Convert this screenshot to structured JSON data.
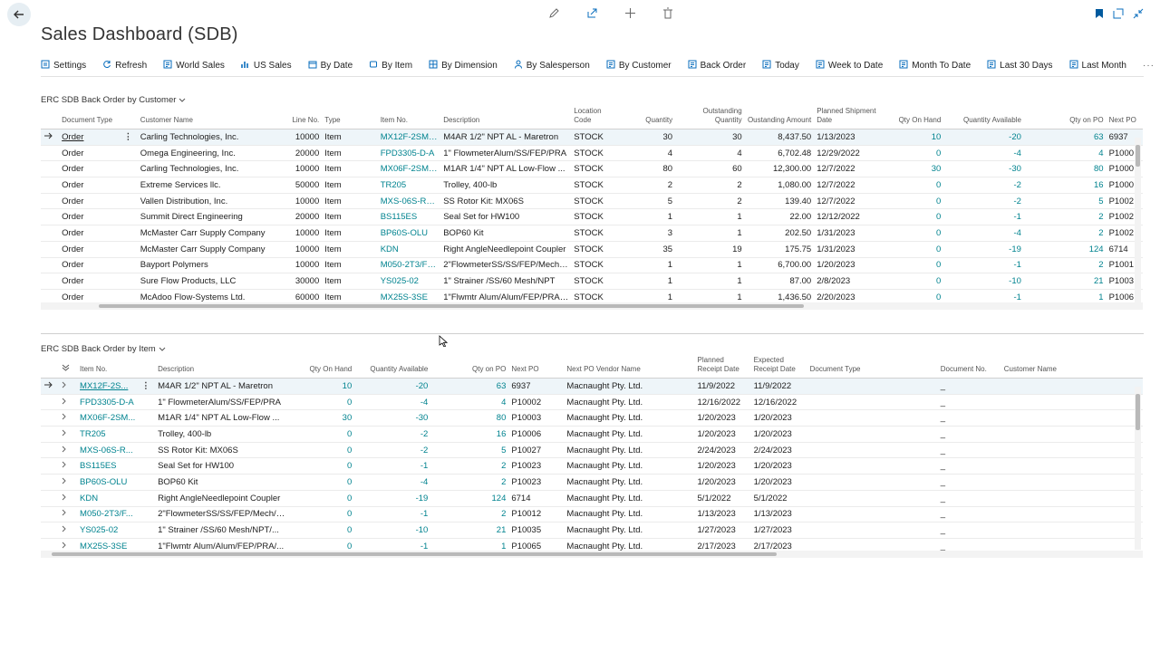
{
  "page": {
    "title": "Sales Dashboard (SDB)"
  },
  "toolbar": [
    {
      "label": "Settings",
      "icon": "settings-icon"
    },
    {
      "label": "Refresh",
      "icon": "refresh-icon"
    },
    {
      "label": "World Sales",
      "icon": "report-icon"
    },
    {
      "label": "US Sales",
      "icon": "chart-icon"
    },
    {
      "label": "By Date",
      "icon": "calendar-icon"
    },
    {
      "label": "By Item",
      "icon": "item-icon"
    },
    {
      "label": "By Dimension",
      "icon": "dimension-icon"
    },
    {
      "label": "By Salesperson",
      "icon": "person-icon"
    },
    {
      "label": "By Customer",
      "icon": "report-icon"
    },
    {
      "label": "Back Order",
      "icon": "report-icon"
    },
    {
      "label": "Today",
      "icon": "report-icon"
    },
    {
      "label": "Week to Date",
      "icon": "report-icon"
    },
    {
      "label": "Month To Date",
      "icon": "report-icon"
    },
    {
      "label": "Last 30 Days",
      "icon": "report-icon"
    },
    {
      "label": "Last Month",
      "icon": "report-icon"
    }
  ],
  "more_label": "···",
  "customer_part": {
    "caption": "ERC SDB Back Order by Customer",
    "headers": {
      "doc_type": "Document Type",
      "customer": "Customer Name",
      "line": "Line No.",
      "type": "Type",
      "item": "Item No.",
      "desc": "Description",
      "loc": "Location Code",
      "qty": "Quantity",
      "outq": "Outstanding Quantity",
      "outamt": "Oustanding Amount",
      "ship": "Planned Shipment Date",
      "onhand": "Qty On Hand",
      "avail": "Quantity Available",
      "onpo": "Qty on PO",
      "nextpo": "Next PO"
    },
    "rows": [
      {
        "doc": "Order",
        "cust": "Carling Technologies, Inc.",
        "line": "10000",
        "type": "Item",
        "item": "MX12F-2SM-...",
        "desc": "M4AR 1/2\" NPT AL - Maretron",
        "loc": "STOCK",
        "qty": "30",
        "outq": "30",
        "amt": "8,437.50",
        "ship": "1/13/2023",
        "onhand": "10",
        "avail": "-20",
        "onpo": "63",
        "nextpo": "6937"
      },
      {
        "doc": "Order",
        "cust": "Omega Engineering, Inc.",
        "line": "20000",
        "type": "Item",
        "item": "FPD3305-D-A",
        "desc": "1\" FlowmeterAlum/SS/FEP/PRA",
        "loc": "STOCK",
        "qty": "4",
        "outq": "4",
        "amt": "6,702.48",
        "ship": "12/29/2022",
        "onhand": "0",
        "avail": "-4",
        "onpo": "4",
        "nextpo": "P1000"
      },
      {
        "doc": "Order",
        "cust": "Carling Technologies, Inc.",
        "line": "10000",
        "type": "Item",
        "item": "MX06F-2SM-...",
        "desc": "M1AR 1/4\" NPT AL Low-Flow ...",
        "loc": "STOCK",
        "qty": "80",
        "outq": "60",
        "amt": "12,300.00",
        "ship": "12/7/2022",
        "onhand": "30",
        "avail": "-30",
        "onpo": "80",
        "nextpo": "P1000"
      },
      {
        "doc": "Order",
        "cust": "Extreme Services llc.",
        "line": "50000",
        "type": "Item",
        "item": "TR205",
        "desc": "Trolley, 400-lb",
        "loc": "STOCK",
        "qty": "2",
        "outq": "2",
        "amt": "1,080.00",
        "ship": "12/7/2022",
        "onhand": "0",
        "avail": "-2",
        "onpo": "16",
        "nextpo": "P1000"
      },
      {
        "doc": "Order",
        "cust": "Vallen Distribution, Inc.",
        "line": "10000",
        "type": "Item",
        "item": "MXS-06S-RO...",
        "desc": "SS Rotor Kit:  MX06S",
        "loc": "STOCK",
        "qty": "5",
        "outq": "2",
        "amt": "139.40",
        "ship": "12/7/2022",
        "onhand": "0",
        "avail": "-2",
        "onpo": "5",
        "nextpo": "P1002"
      },
      {
        "doc": "Order",
        "cust": "Summit Direct Engineering",
        "line": "20000",
        "type": "Item",
        "item": "BS115ES",
        "desc": "Seal Set for HW100",
        "loc": "STOCK",
        "qty": "1",
        "outq": "1",
        "amt": "22.00",
        "ship": "12/12/2022",
        "onhand": "0",
        "avail": "-1",
        "onpo": "2",
        "nextpo": "P1002"
      },
      {
        "doc": "Order",
        "cust": "McMaster Carr Supply Company",
        "line": "10000",
        "type": "Item",
        "item": "BP60S-OLU",
        "desc": "BOP60 Kit",
        "loc": "STOCK",
        "qty": "3",
        "outq": "1",
        "amt": "202.50",
        "ship": "1/31/2023",
        "onhand": "0",
        "avail": "-4",
        "onpo": "2",
        "nextpo": "P1002"
      },
      {
        "doc": "Order",
        "cust": "McMaster Carr Supply Company",
        "line": "10000",
        "type": "Item",
        "item": "KDN",
        "desc": "Right AngleNeedlepoint Coupler",
        "loc": "STOCK",
        "qty": "35",
        "outq": "19",
        "amt": "175.75",
        "ship": "1/31/2023",
        "onhand": "0",
        "avail": "-19",
        "onpo": "124",
        "nextpo": "6714"
      },
      {
        "doc": "Order",
        "cust": "Bayport Polymers",
        "line": "10000",
        "type": "Item",
        "item": "M050-2T3/FK...",
        "desc": "2\"FlowmeterSS/SS/FEP/Mech/F...",
        "loc": "STOCK",
        "qty": "1",
        "outq": "1",
        "amt": "6,700.00",
        "ship": "1/20/2023",
        "onhand": "0",
        "avail": "-1",
        "onpo": "2",
        "nextpo": "P1001"
      },
      {
        "doc": "Order",
        "cust": "Sure Flow Products, LLC",
        "line": "30000",
        "type": "Item",
        "item": "YS025-02",
        "desc": "1\" Strainer /SS/60 Mesh/NPT",
        "loc": "STOCK",
        "qty": "1",
        "outq": "1",
        "amt": "87.00",
        "ship": "2/8/2023",
        "onhand": "0",
        "avail": "-10",
        "onpo": "21",
        "nextpo": "P1003"
      },
      {
        "doc": "Order",
        "cust": "McAdoo Flow-Systems Ltd.",
        "line": "60000",
        "type": "Item",
        "item": "MX25S-3SE",
        "desc": "1\"Flwmtr Alum/Alum/FEP/PRA/...",
        "loc": "STOCK",
        "qty": "1",
        "outq": "1",
        "amt": "1,436.50",
        "ship": "2/20/2023",
        "onhand": "0",
        "avail": "-1",
        "onpo": "1",
        "nextpo": "P1006"
      }
    ]
  },
  "item_part": {
    "caption": "ERC SDB Back Order by Item",
    "headers": {
      "item": "Item No.",
      "desc": "Description",
      "onhand": "Qty On Hand",
      "avail": "Quantity Available",
      "onpo": "Qty on PO",
      "nextpo": "Next PO",
      "vendor": "Next PO Vendor Name",
      "planned": "Planned Receipt Date",
      "expected": "Expected Receipt Date",
      "doctype": "Document Type",
      "docno": "Document No.",
      "cust": "Customer Name"
    },
    "rows": [
      {
        "item": "MX12F-2S...",
        "desc": "M4AR 1/2\" NPT AL - Maretron",
        "onhand": "10",
        "avail": "-20",
        "onpo": "63",
        "nextpo": "6937",
        "vendor": "Macnaught Pty. Ltd.",
        "planned": "11/9/2022",
        "expected": "11/9/2022",
        "docno": "_"
      },
      {
        "item": "FPD3305-D-A",
        "desc": "1\" FlowmeterAlum/SS/FEP/PRA",
        "onhand": "0",
        "avail": "-4",
        "onpo": "4",
        "nextpo": "P10002",
        "vendor": "Macnaught Pty. Ltd.",
        "planned": "12/16/2022",
        "expected": "12/16/2022",
        "docno": "_"
      },
      {
        "item": "MX06F-2SM...",
        "desc": "M1AR 1/4\" NPT AL Low-Flow ...",
        "onhand": "30",
        "avail": "-30",
        "onpo": "80",
        "nextpo": "P10003",
        "vendor": "Macnaught Pty. Ltd.",
        "planned": "1/20/2023",
        "expected": "1/20/2023",
        "docno": "_"
      },
      {
        "item": "TR205",
        "desc": "Trolley, 400-lb",
        "onhand": "0",
        "avail": "-2",
        "onpo": "16",
        "nextpo": "P10006",
        "vendor": "Macnaught Pty. Ltd.",
        "planned": "1/20/2023",
        "expected": "1/20/2023",
        "docno": "_"
      },
      {
        "item": "MXS-06S-R...",
        "desc": "SS Rotor Kit:  MX06S",
        "onhand": "0",
        "avail": "-2",
        "onpo": "5",
        "nextpo": "P10027",
        "vendor": "Macnaught Pty. Ltd.",
        "planned": "2/24/2023",
        "expected": "2/24/2023",
        "docno": "_"
      },
      {
        "item": "BS115ES",
        "desc": "Seal Set for HW100",
        "onhand": "0",
        "avail": "-1",
        "onpo": "2",
        "nextpo": "P10023",
        "vendor": "Macnaught Pty. Ltd.",
        "planned": "1/20/2023",
        "expected": "1/20/2023",
        "docno": "_"
      },
      {
        "item": "BP60S-OLU",
        "desc": "BOP60 Kit",
        "onhand": "0",
        "avail": "-4",
        "onpo": "2",
        "nextpo": "P10023",
        "vendor": "Macnaught Pty. Ltd.",
        "planned": "1/20/2023",
        "expected": "1/20/2023",
        "docno": "_"
      },
      {
        "item": "KDN",
        "desc": "Right AngleNeedlepoint Coupler",
        "onhand": "0",
        "avail": "-19",
        "onpo": "124",
        "nextpo": "6714",
        "vendor": "Macnaught Pty. Ltd.",
        "planned": "5/1/2022",
        "expected": "5/1/2022",
        "docno": "_"
      },
      {
        "item": "M050-2T3/F...",
        "desc": "2\"FlowmeterSS/SS/FEP/Mech/F...",
        "onhand": "0",
        "avail": "-1",
        "onpo": "2",
        "nextpo": "P10012",
        "vendor": "Macnaught Pty. Ltd.",
        "planned": "1/13/2023",
        "expected": "1/13/2023",
        "docno": "_"
      },
      {
        "item": "YS025-02",
        "desc": "1\" Strainer /SS/60 Mesh/NPT/...",
        "onhand": "0",
        "avail": "-10",
        "onpo": "21",
        "nextpo": "P10035",
        "vendor": "Macnaught Pty. Ltd.",
        "planned": "1/27/2023",
        "expected": "1/27/2023",
        "docno": "_"
      },
      {
        "item": "MX25S-3SE",
        "desc": "1\"Flwmtr Alum/Alum/FEP/PRA/...",
        "onhand": "0",
        "avail": "-1",
        "onpo": "1",
        "nextpo": "P10065",
        "vendor": "Macnaught Pty. Ltd.",
        "planned": "2/17/2023",
        "expected": "2/17/2023",
        "docno": "_"
      }
    ]
  },
  "colors": {
    "accent": "#00838f",
    "brand": "#008272",
    "selected_row": "#eef5f9"
  }
}
